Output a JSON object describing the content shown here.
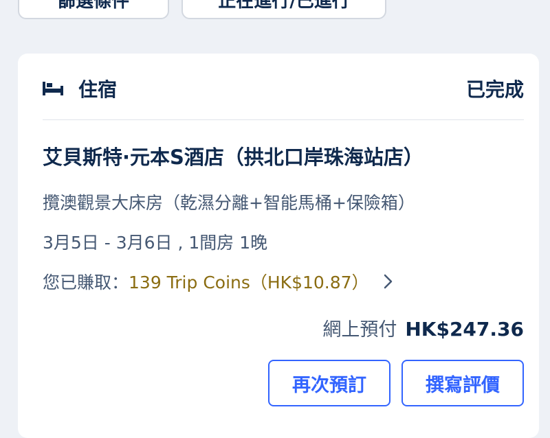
{
  "filter_chips": {
    "left_label": "篩選條件",
    "right_label": "正在進行/已進行"
  },
  "booking": {
    "type_icon": "bed-icon",
    "type_label": "住宿",
    "status": "已完成",
    "hotel_name": "艾貝斯特·元本S酒店（拱北口岸珠海站店）",
    "room_type": "攬澳觀景大床房（乾濕分離+智能馬桶+保險箱）",
    "dates": "3月5日 - 3月6日 , 1間房 1晚",
    "coins_prefix": "您已賺取：",
    "coins_value": "139 Trip Coins（HK$10.87）",
    "price_label": "網上預付",
    "price_value": "HK$247.36",
    "rebook_label": "再次預訂",
    "review_label": "撰寫評價"
  },
  "colors": {
    "primary": "#3264ff",
    "title_text": "#0f294d",
    "secondary_text": "#455873",
    "coins_text": "#8b6d12",
    "page_background": "#eef1f6"
  }
}
